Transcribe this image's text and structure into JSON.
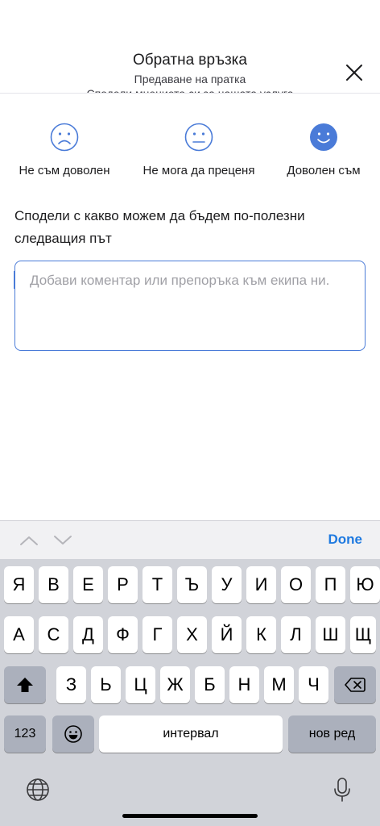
{
  "header": {
    "title": "Обратна връзка",
    "subtitle": "Предаване на пратка",
    "clipped_line": "Сподели мнението си за нашата услуга"
  },
  "rating": {
    "options": [
      {
        "label": "Не съм доволен",
        "icon": "sad-face-icon",
        "selected": false
      },
      {
        "label": "Не мога да преценя",
        "icon": "neutral-face-icon",
        "selected": false
      },
      {
        "label": "Доволен съм",
        "icon": "happy-face-icon",
        "selected": true
      }
    ]
  },
  "prompt": "Сподели с какво можем да бъдем по-полезни следващия път",
  "comment": {
    "value": "",
    "placeholder": "Добави коментар или препоръка към екипа ни."
  },
  "accessory": {
    "done_label": "Done"
  },
  "keyboard": {
    "row1": [
      "Я",
      "В",
      "Е",
      "Р",
      "Т",
      "Ъ",
      "У",
      "И",
      "О",
      "П",
      "Ю"
    ],
    "row2": [
      "А",
      "С",
      "Д",
      "Ф",
      "Г",
      "Х",
      "Й",
      "К",
      "Л",
      "Ш",
      "Щ"
    ],
    "row3": [
      "З",
      "Ь",
      "Ц",
      "Ж",
      "Б",
      "Н",
      "М",
      "Ч"
    ],
    "numbers_label": "123",
    "space_label": "интервал",
    "return_label": "нов ред"
  },
  "colors": {
    "accent": "#4a7bd8",
    "done": "#1f7ae0",
    "keyboard_bg": "#d1d3d9",
    "function_key": "#abb0bc"
  }
}
